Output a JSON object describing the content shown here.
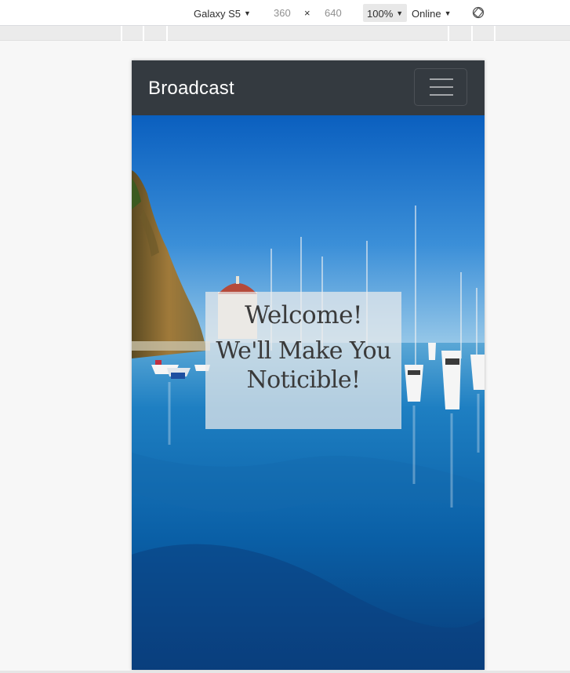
{
  "devtools": {
    "device": "Galaxy S5",
    "width": "360",
    "times": "×",
    "height": "640",
    "zoom": "100%",
    "network": "Online",
    "caret": "▼",
    "rotate_icon": "rotate-icon"
  },
  "navbar": {
    "brand": "Broadcast",
    "toggler_icon": "hamburger-icon",
    "background": "#343a40"
  },
  "hero": {
    "welcome": "Welcome!",
    "tagline": "We'll Make You Noticible!"
  }
}
